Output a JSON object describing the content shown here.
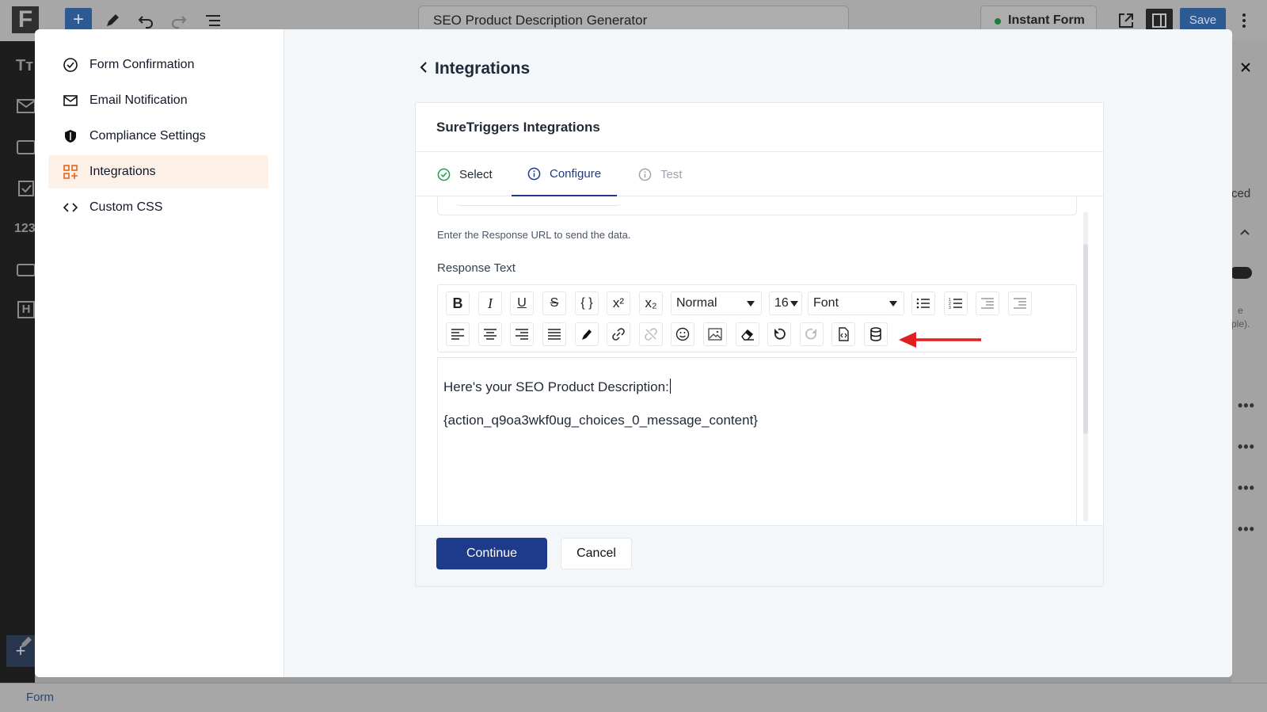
{
  "editor_bar": {
    "logo_letter": "F",
    "document_title": "SEO Product Description Generator",
    "instant_form_label": "Instant Form",
    "save_label": "Save"
  },
  "left_rail": {
    "heading_icon": "Tт",
    "number_icon": "123",
    "h_icon": "H"
  },
  "right_panel": {
    "advanced_fragment": "ced",
    "hint_fragment_1": "e",
    "hint_fragment_2": "ple)."
  },
  "bottom_bar": {
    "form_label": "Form"
  },
  "modal": {
    "nav": [
      {
        "label": "Form Confirmation",
        "icon": "check-circle-icon"
      },
      {
        "label": "Email Notification",
        "icon": "mail-icon"
      },
      {
        "label": "Compliance Settings",
        "icon": "shield-icon"
      },
      {
        "label": "Integrations",
        "icon": "integrations-grid-icon",
        "active": true
      },
      {
        "label": "Custom CSS",
        "icon": "code-icon"
      }
    ],
    "page_title": "Integrations",
    "card": {
      "title": "SureTriggers Integrations",
      "tabs": [
        {
          "label": "Select",
          "state": "completed"
        },
        {
          "label": "Configure",
          "state": "active"
        },
        {
          "label": "Test",
          "state": "pending"
        }
      ],
      "response_url_help": "Enter the Response URL to send the data.",
      "response_text_label": "Response Text",
      "toolbar": {
        "header_select": "Normal",
        "size_select": "16",
        "font_select": "Font"
      },
      "editor_lines": [
        "Here's your SEO Product Description:",
        "{action_q9oa3wkf0ug_choices_0_message_content}"
      ],
      "continue_label": "Continue",
      "cancel_label": "Cancel"
    }
  },
  "colors": {
    "primary": "#1e3a8a",
    "active_nav_bg": "#fdf0e6",
    "accent_orange": "#e8641b",
    "success_green": "#16a34a",
    "annotation_red": "#e02020"
  }
}
